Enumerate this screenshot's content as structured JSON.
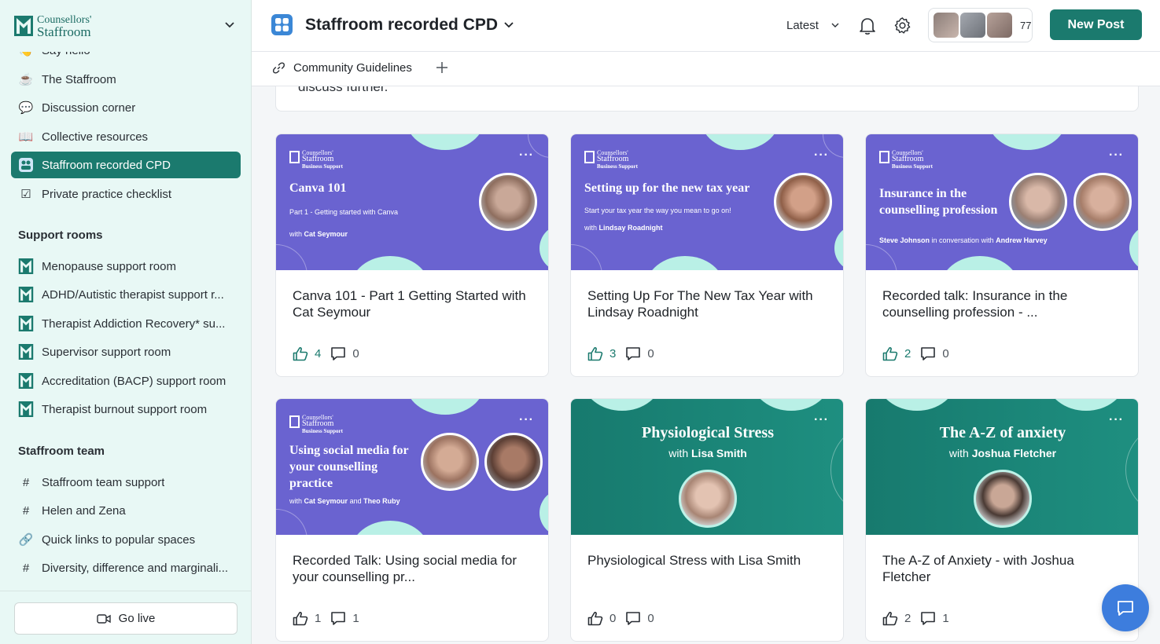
{
  "brand": {
    "line1": "Counsellors'",
    "line2": "Staffroom"
  },
  "sidebar": {
    "top_items": [
      {
        "icon": "👋",
        "icon_name": "wave-icon",
        "label": "Say hello"
      },
      {
        "icon": "☕",
        "icon_name": "coffee-icon",
        "label": "The Staffroom"
      },
      {
        "icon": "💬",
        "icon_name": "speech-bubble-icon",
        "label": "Discussion corner"
      },
      {
        "icon": "📖",
        "icon_name": "book-icon",
        "label": "Collective resources"
      },
      {
        "icon": "▦",
        "icon_name": "video-grid-icon",
        "label": "Staffroom recorded CPD",
        "active": true
      },
      {
        "icon": "☑",
        "icon_name": "checkbox-icon",
        "label": "Private practice checklist"
      }
    ],
    "support_title": "Support rooms",
    "support_items": [
      {
        "label": "Menopause support room"
      },
      {
        "label": "ADHD/Autistic therapist support r..."
      },
      {
        "label": "Therapist Addiction Recovery* su..."
      },
      {
        "label": "Supervisor support room"
      },
      {
        "label": "Accreditation (BACP) support room"
      },
      {
        "label": "Therapist burnout support room"
      }
    ],
    "team_title": "Staffroom team",
    "team_items": [
      {
        "icon": "#",
        "icon_name": "hash-icon",
        "label": "Staffroom team support"
      },
      {
        "icon": "#",
        "icon_name": "hash-icon",
        "label": "Helen and Zena"
      },
      {
        "icon": "🔗",
        "icon_name": "link-icon",
        "label": "Quick links to popular spaces"
      },
      {
        "icon": "#",
        "icon_name": "hash-icon",
        "label": "Diversity, difference and marginali..."
      }
    ],
    "go_live": "Go live"
  },
  "header": {
    "title": "Staffroom recorded CPD",
    "sort": "Latest",
    "member_count": "77",
    "new_post": "New Post"
  },
  "subbar": {
    "guidelines": "Community Guidelines"
  },
  "previous_post_text": "discuss further.",
  "colors": {
    "brand": "#1b7a6e",
    "purple_cover": "#6a63d0",
    "mint": "#b9f0e6",
    "chat": "#3d7ddd"
  },
  "cards": [
    {
      "title": "Canva 101 - Part 1 Getting Started with Cat Seymour",
      "likes": "4",
      "comments": "0",
      "cover": {
        "logo_1": "Counsellors'",
        "logo_2": "Staffroom",
        "logo_3": "Business Support",
        "heading": "Canva 101",
        "sub": "Part 1 - Getting started with Canva",
        "with": "with",
        "with_name": "Cat Seymour"
      }
    },
    {
      "title": "Setting Up For The New Tax Year with Lindsay Roadnight",
      "likes": "3",
      "comments": "0",
      "cover": {
        "logo_1": "Counsellors'",
        "logo_2": "Staffroom",
        "logo_3": "Business Support",
        "heading": "Setting up for the new tax year",
        "sub": "Start your tax year the way you mean to go on!",
        "with": "with",
        "with_name": "Lindsay Roadnight"
      }
    },
    {
      "title": "Recorded talk: Insurance in the counselling profession - ...",
      "likes": "2",
      "comments": "0",
      "cover": {
        "logo_1": "Counsellors'",
        "logo_2": "Staffroom",
        "logo_3": "Business Support",
        "heading_1": "Insurance in the",
        "heading_2": "counselling profession",
        "name_a": "Steve Johnson",
        "mid": "in conversation with",
        "name_b": "Andrew Harvey"
      }
    },
    {
      "title": "Recorded Talk: Using social media for your counselling pr...",
      "likes": "1",
      "comments": "1",
      "cover": {
        "logo_1": "Counsellors'",
        "logo_2": "Staffroom",
        "logo_3": "Business Support",
        "heading_1": "Using social media for",
        "heading_2": "your counselling",
        "heading_3": "practice",
        "with": "with",
        "name_a": "Cat Seymour",
        "and": "and",
        "name_b": "Theo Ruby"
      }
    },
    {
      "title": "Physiological Stress with Lisa Smith",
      "likes": "0",
      "comments": "0",
      "cover": {
        "heading": "Physiological Stress",
        "with": "with",
        "with_name": "Lisa Smith"
      }
    },
    {
      "title": "The A-Z of Anxiety - with Joshua Fletcher",
      "likes": "2",
      "comments": "1",
      "cover": {
        "heading": "The A-Z of anxiety",
        "with": "with",
        "with_name": "Joshua Fletcher"
      }
    }
  ]
}
